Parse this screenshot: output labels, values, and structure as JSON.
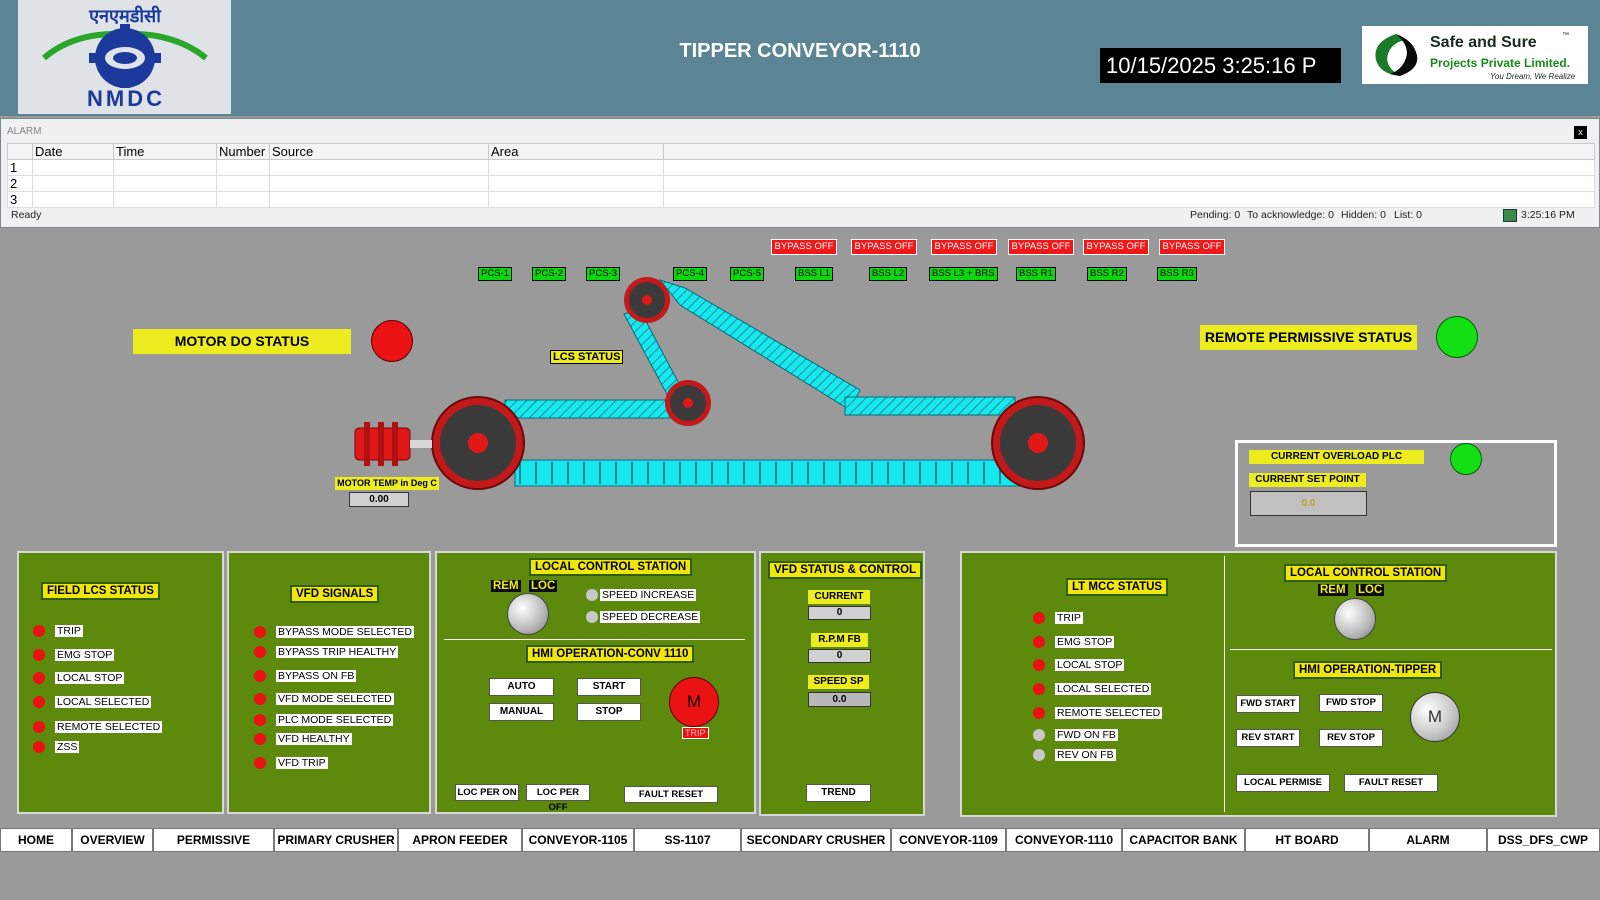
{
  "header": {
    "nmdc_hindi": "एनएमडीसी",
    "nmdc_logo_text": "NMDC",
    "title": "TIPPER CONVEYOR-1110",
    "clock": "10/15/2025 3:25:16 P",
    "company_name": "Safe and Sure",
    "company_tm": "™",
    "company_sub": "Projects Private Limited.",
    "company_tagline": "You Dream, We Realize"
  },
  "alarm": {
    "title": "ALARM",
    "close": "x",
    "columns": [
      "Date",
      "Time",
      "Number",
      "Source",
      "Area"
    ],
    "rows": [
      "1",
      "2",
      "3"
    ],
    "status_left": "Ready",
    "pending": "Pending: 0",
    "to_ack": "To acknowledge: 0",
    "hidden": "Hidden: 0",
    "list": "List: 0",
    "time": "3:25:16 PM"
  },
  "bypass": [
    "BYPASS OFF",
    "BYPASS OFF",
    "BYPASS OFF",
    "BYPASS OFF",
    "BYPASS OFF",
    "BYPASS OFF"
  ],
  "pcs": [
    "PCS-1",
    "PCS-2",
    "PCS-3",
    "PCS-4",
    "PCS-5",
    "BSS L1",
    "BSS L2",
    "BSS L3 + BRS",
    "BSS R1",
    "BSS R2",
    "BSS R3"
  ],
  "motor_do_status": "MOTOR DO STATUS",
  "remote_permissive_status": "REMOTE PERMISSIVE STATUS",
  "lcs_status": "LCS STATUS",
  "motor_temp_label": "MOTOR TEMP in Deg C",
  "motor_temp_value": "0.00",
  "overload": {
    "current_overload": "CURRENT OVERLOAD PLC",
    "current_set_point": "CURRENT SET POINT",
    "set_point_value": "0.0"
  },
  "field_lcs": {
    "title": "FIELD LCS STATUS",
    "items": [
      "TRIP",
      "EMG STOP",
      "LOCAL STOP",
      "LOCAL SELECTED",
      "REMOTE SELECTED",
      "ZSS"
    ]
  },
  "vfd_signals": {
    "title": "VFD SIGNALS",
    "items": [
      "BYPASS MODE SELECTED",
      "BYPASS TRIP HEALTHY",
      "BYPASS ON FB",
      "VFD MODE SELECTED",
      "PLC MODE SELECTED",
      "VFD HEALTHY",
      "VFD TRIP"
    ]
  },
  "lcs_conv": {
    "title": "LOCAL CONTROL STATION",
    "rem": "REM",
    "loc": "LOC",
    "speed_increase": "SPEED INCREASE",
    "speed_decrease": "SPEED DECREASE",
    "hmi_title": "HMI OPERATION-CONV 1110",
    "auto": "AUTO",
    "manual": "MANUAL",
    "start": "START",
    "stop": "STOP",
    "motor": "M",
    "trip": "TRIP",
    "loc_per_on": "LOC PER ON",
    "loc_per_off": "LOC PER OFF",
    "fault_reset": "FAULT RESET"
  },
  "vfd_status": {
    "title": "VFD STATUS & CONTROL",
    "current_fb": "CURRENT FB",
    "current_fb_value": "0",
    "rpm_fb": "R.P.M FB",
    "rpm_fb_value": "0",
    "speed_sp": "SPEED SP",
    "speed_sp_value": "0.0",
    "trend": "TREND"
  },
  "lt_mcc": {
    "title": "LT MCC STATUS",
    "items": [
      {
        "label": "TRIP",
        "state": "red"
      },
      {
        "label": "EMG STOP",
        "state": "red"
      },
      {
        "label": "LOCAL STOP",
        "state": "red"
      },
      {
        "label": "LOCAL SELECTED",
        "state": "red"
      },
      {
        "label": "REMOTE SELECTED",
        "state": "red"
      },
      {
        "label": "FWD ON FB",
        "state": "grey"
      },
      {
        "label": "REV ON FB",
        "state": "grey"
      }
    ]
  },
  "lcs_tipper": {
    "title": "LOCAL CONTROL STATION",
    "rem": "REM",
    "loc": "LOC",
    "hmi_title": "HMI OPERATION-TIPPER",
    "fwd_start": "FWD START",
    "fwd_stop": "FWD STOP",
    "rev_start": "REV START",
    "rev_stop": "REV STOP",
    "motor": "M",
    "local_permise": "LOCAL PERMISE",
    "fault_reset": "FAULT RESET"
  },
  "nav": [
    "HOME",
    "OVERVIEW",
    "PERMISSIVE",
    "PRIMARY CRUSHER",
    "APRON FEEDER",
    "CONVEYOR-1105",
    "SS-1107",
    "SECONDARY CRUSHER",
    "CONVEYOR-1109",
    "CONVEYOR-1110",
    "CAPACITOR BANK",
    "HT BOARD",
    "ALARM",
    "DSS_DFS_CWP"
  ],
  "colors": {
    "header_bg": "#5b8594",
    "panel_green": "#5d8a0d",
    "lamp_red": "#ea1212",
    "lamp_green": "#13e013",
    "belt_cyan": "#18e8ee",
    "label_yellow": "#ecec1e"
  }
}
